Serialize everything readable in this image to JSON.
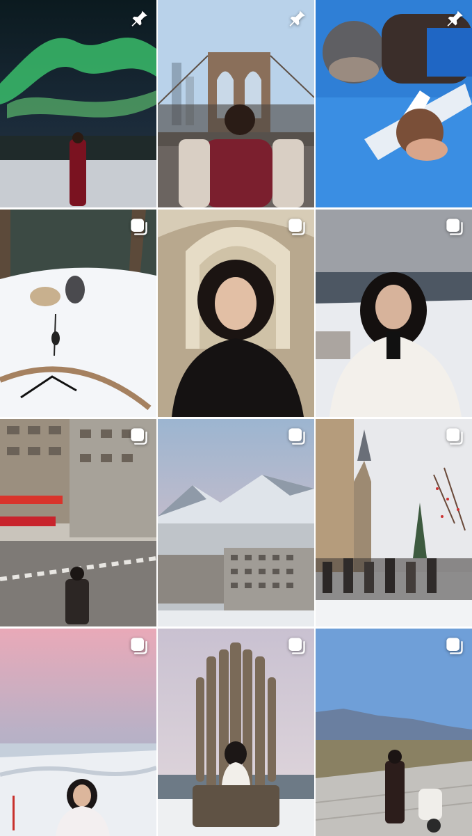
{
  "profile_grid": {
    "posts": [
      {
        "id": "aurora",
        "badge": "pin-icon"
      },
      {
        "id": "brooklyn-bridge",
        "badge": "pin-icon"
      },
      {
        "id": "skydive",
        "badge": "pin-icon"
      },
      {
        "id": "dog-sled",
        "badge": "carousel-icon"
      },
      {
        "id": "arched-hall-portrait",
        "badge": "carousel-icon"
      },
      {
        "id": "snowy-coast-portrait",
        "badge": "carousel-icon"
      },
      {
        "id": "city-street",
        "badge": "carousel-icon"
      },
      {
        "id": "mountain-town",
        "badge": "carousel-icon"
      },
      {
        "id": "red-square-crowd",
        "badge": "carousel-icon"
      },
      {
        "id": "pink-sky-snow",
        "badge": "carousel-icon"
      },
      {
        "id": "wooden-throne",
        "badge": "carousel-icon"
      },
      {
        "id": "lakeside-boardwalk",
        "badge": "carousel-icon"
      }
    ]
  }
}
